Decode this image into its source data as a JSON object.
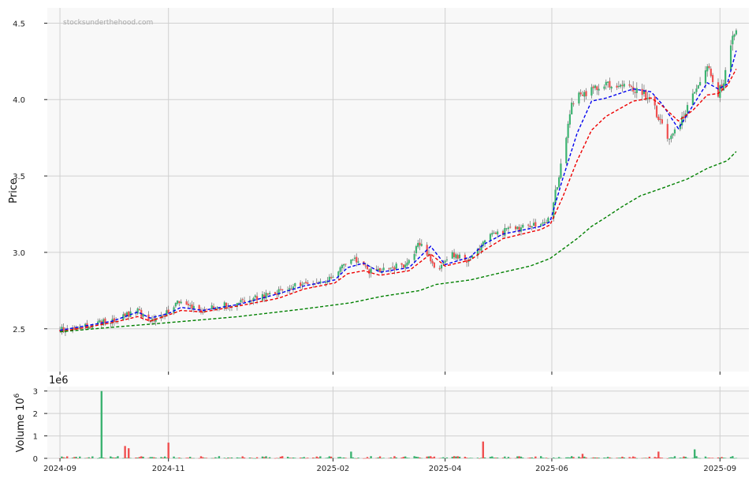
{
  "chart_data": {
    "type": "candlestick",
    "watermark": "stocksunderthehood.com",
    "price_panel": {
      "ylabel": "Price",
      "ylim": [
        2.22,
        4.6
      ],
      "yticks": [
        2.5,
        3.0,
        3.5,
        4.0,
        4.5
      ],
      "ytick_labels": [
        "2.5",
        "3.0",
        "3.5",
        "4.0",
        "4.5"
      ],
      "grid": true,
      "up_color": "#3cb371",
      "down_color": "#f05050",
      "moving_averages": [
        {
          "style": "dashed",
          "color": "#0000ee",
          "points": [
            [
              "2024-09-02",
              2.49
            ],
            [
              "2024-10-01",
              2.55
            ],
            [
              "2024-10-15",
              2.61
            ],
            [
              "2024-10-22",
              2.57
            ],
            [
              "2024-11-01",
              2.6
            ],
            [
              "2024-11-08",
              2.64
            ],
            [
              "2024-11-20",
              2.62
            ],
            [
              "2024-12-10",
              2.66
            ],
            [
              "2025-01-01",
              2.73
            ],
            [
              "2025-01-15",
              2.78
            ],
            [
              "2025-02-01",
              2.82
            ],
            [
              "2025-02-08",
              2.9
            ],
            [
              "2025-02-17",
              2.93
            ],
            [
              "2025-02-26",
              2.87
            ],
            [
              "2025-03-14",
              2.9
            ],
            [
              "2025-03-26",
              3.04
            ],
            [
              "2025-04-03",
              2.92
            ],
            [
              "2025-04-17",
              2.97
            ],
            [
              "2025-04-24",
              3.05
            ],
            [
              "2025-05-05",
              3.12
            ],
            [
              "2025-05-26",
              3.17
            ],
            [
              "2025-05-31",
              3.2
            ],
            [
              "2025-06-07",
              3.48
            ],
            [
              "2025-06-15",
              3.78
            ],
            [
              "2025-06-23",
              3.99
            ],
            [
              "2025-07-01",
              4.01
            ],
            [
              "2025-07-16",
              4.07
            ],
            [
              "2025-07-26",
              4.05
            ],
            [
              "2025-08-01",
              3.97
            ],
            [
              "2025-08-10",
              3.81
            ],
            [
              "2025-08-18",
              3.96
            ],
            [
              "2025-08-26",
              4.11
            ],
            [
              "2025-09-01",
              4.07
            ],
            [
              "2025-09-06",
              4.1
            ],
            [
              "2025-09-11",
              4.32
            ]
          ]
        },
        {
          "style": "dashed",
          "color": "#ee0000",
          "points": [
            [
              "2024-09-02",
              2.48
            ],
            [
              "2024-10-01",
              2.54
            ],
            [
              "2024-10-15",
              2.58
            ],
            [
              "2024-10-22",
              2.55
            ],
            [
              "2024-11-01",
              2.59
            ],
            [
              "2024-11-08",
              2.62
            ],
            [
              "2024-11-20",
              2.61
            ],
            [
              "2024-12-10",
              2.65
            ],
            [
              "2025-01-01",
              2.7
            ],
            [
              "2025-01-15",
              2.76
            ],
            [
              "2025-02-01",
              2.8
            ],
            [
              "2025-02-08",
              2.86
            ],
            [
              "2025-02-17",
              2.88
            ],
            [
              "2025-02-26",
              2.85
            ],
            [
              "2025-03-14",
              2.88
            ],
            [
              "2025-03-26",
              2.99
            ],
            [
              "2025-04-03",
              2.91
            ],
            [
              "2025-04-17",
              2.95
            ],
            [
              "2025-04-24",
              3.01
            ],
            [
              "2025-05-05",
              3.09
            ],
            [
              "2025-05-26",
              3.15
            ],
            [
              "2025-05-31",
              3.18
            ],
            [
              "2025-06-07",
              3.36
            ],
            [
              "2025-06-15",
              3.6
            ],
            [
              "2025-06-23",
              3.8
            ],
            [
              "2025-07-01",
              3.89
            ],
            [
              "2025-07-16",
              3.99
            ],
            [
              "2025-07-26",
              4.01
            ],
            [
              "2025-08-01",
              3.96
            ],
            [
              "2025-08-10",
              3.86
            ],
            [
              "2025-08-18",
              3.93
            ],
            [
              "2025-08-26",
              4.03
            ],
            [
              "2025-09-01",
              4.04
            ],
            [
              "2025-09-06",
              4.09
            ],
            [
              "2025-09-11",
              4.2
            ]
          ]
        },
        {
          "style": "dashed",
          "color": "#008000",
          "points": [
            [
              "2024-09-02",
              2.48
            ],
            [
              "2024-10-01",
              2.51
            ],
            [
              "2024-11-01",
              2.54
            ],
            [
              "2024-12-10",
              2.58
            ],
            [
              "2025-01-15",
              2.63
            ],
            [
              "2025-02-10",
              2.67
            ],
            [
              "2025-02-26",
              2.71
            ],
            [
              "2025-03-20",
              2.75
            ],
            [
              "2025-03-29",
              2.79
            ],
            [
              "2025-04-17",
              2.82
            ],
            [
              "2025-05-05",
              2.87
            ],
            [
              "2025-05-20",
              2.91
            ],
            [
              "2025-05-31",
              2.96
            ],
            [
              "2025-06-07",
              3.02
            ],
            [
              "2025-06-15",
              3.09
            ],
            [
              "2025-06-23",
              3.17
            ],
            [
              "2025-07-01",
              3.23
            ],
            [
              "2025-07-10",
              3.3
            ],
            [
              "2025-07-20",
              3.37
            ],
            [
              "2025-08-01",
              3.42
            ],
            [
              "2025-08-15",
              3.48
            ],
            [
              "2025-08-26",
              3.55
            ],
            [
              "2025-09-06",
              3.6
            ],
            [
              "2025-09-11",
              3.66
            ]
          ]
        }
      ]
    },
    "volume_panel": {
      "ylabel": "Volume",
      "scale_label": "1e6",
      "ylim": [
        0,
        3.2
      ],
      "yticks": [
        0,
        1,
        2,
        3
      ],
      "ytick_labels": [
        "0",
        "1",
        "2",
        "3"
      ],
      "grid": true
    },
    "xlim": [
      "2024-08-26",
      "2025-09-18"
    ],
    "xticks": [
      "2024-09-02",
      "2024-11-01",
      "2025-01-31",
      "2025-04-03",
      "2025-06-01",
      "2025-09-02"
    ],
    "xtick_labels": [
      "2024-09",
      "2024-11",
      "2025-02",
      "2025-04",
      "2025-06",
      "2025-09"
    ],
    "trend_anchors": [
      [
        "2024-09-02",
        2.49
      ],
      [
        "2024-10-01",
        2.55
      ],
      [
        "2024-10-15",
        2.62
      ],
      [
        "2024-10-24",
        2.55
      ],
      [
        "2024-11-01",
        2.61
      ],
      [
        "2024-11-08",
        2.68
      ],
      [
        "2024-11-20",
        2.62
      ],
      [
        "2024-12-10",
        2.67
      ],
      [
        "2025-01-01",
        2.74
      ],
      [
        "2025-01-15",
        2.8
      ],
      [
        "2025-02-01",
        2.83
      ],
      [
        "2025-02-10",
        2.98
      ],
      [
        "2025-02-20",
        2.88
      ],
      [
        "2025-03-14",
        2.92
      ],
      [
        "2025-03-22",
        3.1
      ],
      [
        "2025-03-29",
        2.87
      ],
      [
        "2025-04-07",
        3.0
      ],
      [
        "2025-04-17",
        2.93
      ],
      [
        "2025-04-28",
        3.12
      ],
      [
        "2025-05-10",
        3.14
      ],
      [
        "2025-05-31",
        3.2
      ],
      [
        "2025-06-07",
        3.55
      ],
      [
        "2025-06-14",
        4.05
      ],
      [
        "2025-06-23",
        4.05
      ],
      [
        "2025-07-01",
        4.1
      ],
      [
        "2025-07-16",
        4.07
      ],
      [
        "2025-07-26",
        4.02
      ],
      [
        "2025-08-06",
        3.72
      ],
      [
        "2025-08-18",
        3.98
      ],
      [
        "2025-08-26",
        4.25
      ],
      [
        "2025-09-01",
        4.02
      ],
      [
        "2025-09-06",
        4.15
      ],
      [
        "2025-09-11",
        4.48
      ]
    ],
    "volume_spikes": [
      [
        "2024-09-25",
        3.0,
        "up"
      ],
      [
        "2024-10-05",
        0.7,
        "down"
      ],
      [
        "2024-10-08",
        0.55,
        "down"
      ],
      [
        "2024-10-10",
        0.45,
        "down"
      ],
      [
        "2024-11-01",
        0.7,
        "down"
      ],
      [
        "2025-01-05",
        0.2,
        "down"
      ],
      [
        "2025-02-10",
        0.3,
        "up"
      ],
      [
        "2025-03-02",
        0.15,
        "up"
      ],
      [
        "2025-03-22",
        0.22,
        "down"
      ],
      [
        "2025-04-24",
        0.75,
        "down"
      ],
      [
        "2025-06-15",
        0.5,
        "up"
      ],
      [
        "2025-06-18",
        0.2,
        "down"
      ],
      [
        "2025-07-30",
        0.3,
        "down"
      ],
      [
        "2025-08-19",
        0.4,
        "up"
      ],
      [
        "2025-09-07",
        0.1,
        "up"
      ]
    ]
  }
}
